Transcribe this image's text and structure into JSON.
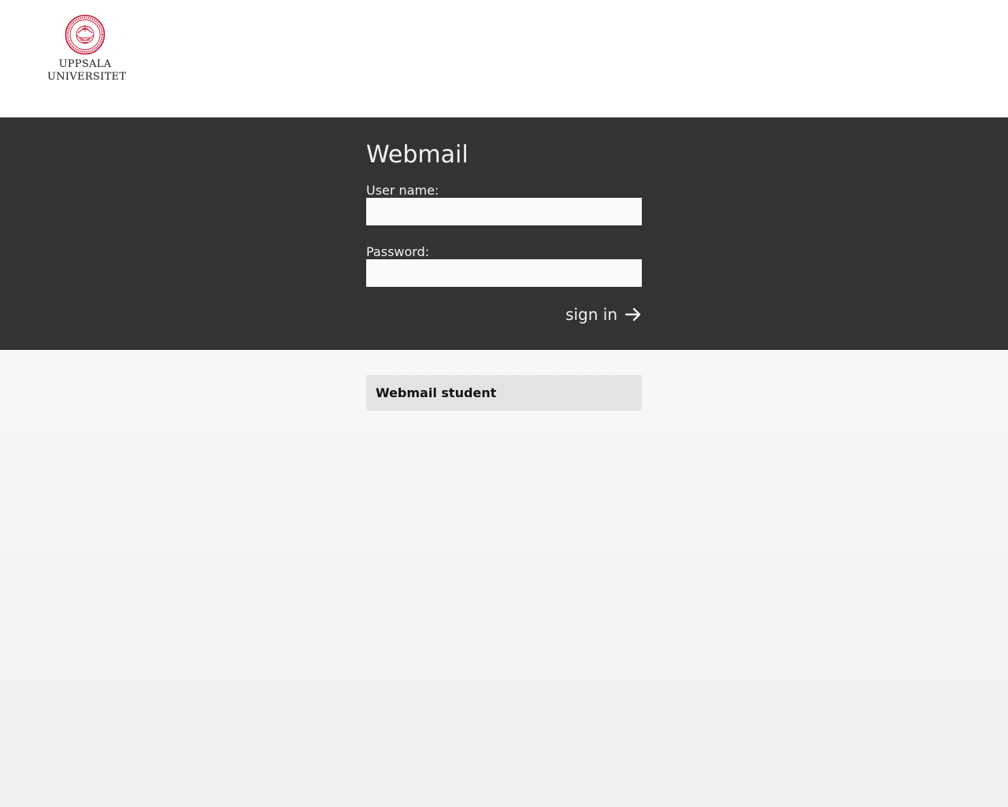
{
  "header": {
    "logo": {
      "line1": "UPPSALA",
      "line2": "UNIVERSITET",
      "icon": "university-seal-icon",
      "color": "#c8102e"
    }
  },
  "login": {
    "title": "Webmail",
    "username_label": "User name:",
    "username_value": "",
    "password_label": "Password:",
    "password_value": "",
    "signin_label": "sign in",
    "signin_icon": "arrow-right-icon"
  },
  "links": {
    "alt_login_label": "Webmail student"
  },
  "colors": {
    "band": "#333333",
    "text_light": "#f2f2f2",
    "input_bg": "#fafafa",
    "link_bg": "#e3e3e3"
  }
}
